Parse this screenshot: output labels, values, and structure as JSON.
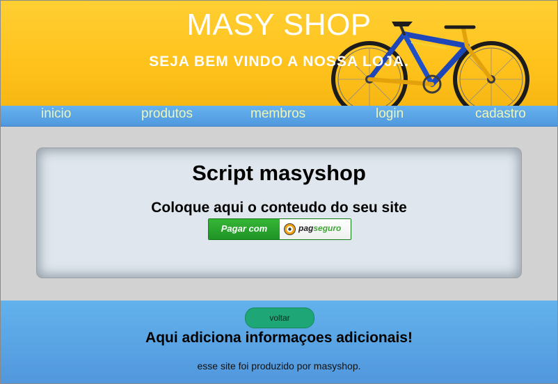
{
  "header": {
    "title": "MASY SHOP",
    "subtitle": "SEJA BEM VINDO A NOSSA LOJA.",
    "background_color": "#ffc21c",
    "image": "bicycle-image"
  },
  "nav": {
    "items": [
      {
        "label": "inicio"
      },
      {
        "label": "produtos"
      },
      {
        "label": "membros"
      },
      {
        "label": "login"
      },
      {
        "label": "cadastro"
      }
    ],
    "background_color": "#5aa5e6",
    "text_color": "#f0f5b8"
  },
  "content": {
    "title": "Script masyshop",
    "subtitle": "Coloque aqui o conteudo do seu site",
    "pay_button": {
      "label": "Pagar com",
      "brand_prefix": "pag",
      "brand_suffix": "seguro",
      "color": "#2aa52d"
    }
  },
  "footer": {
    "back_label": "voltar",
    "title": "Aqui adiciona informaçoes adicionais!",
    "credit": "esse site foi produzido por masyshop.",
    "background_color": "#5aa5e6"
  }
}
